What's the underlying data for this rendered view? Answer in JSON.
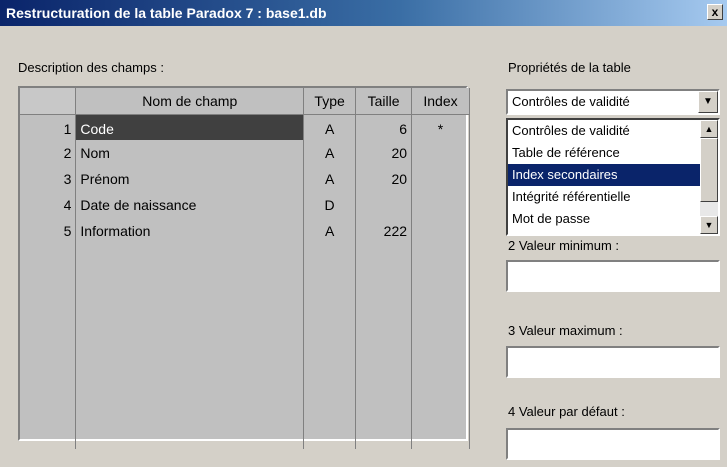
{
  "window": {
    "title": "Restructuration de la table Paradox 7 : base1.db",
    "close_label": "x"
  },
  "fields_section": {
    "label": "Description des champs :",
    "columns": [
      "",
      "Nom de champ",
      "Type",
      "Taille",
      "Index"
    ],
    "rows": [
      {
        "num": "1",
        "name": "Code",
        "type": "A",
        "size": "6",
        "index": "*"
      },
      {
        "num": "2",
        "name": "Nom",
        "type": "A",
        "size": "20",
        "index": ""
      },
      {
        "num": "3",
        "name": "Prénom",
        "type": "A",
        "size": "20",
        "index": ""
      },
      {
        "num": "4",
        "name": "Date de naissance",
        "type": "D",
        "size": "",
        "index": ""
      },
      {
        "num": "5",
        "name": "Information",
        "type": "A",
        "size": "222",
        "index": ""
      }
    ],
    "selected_row": 0
  },
  "table_properties": {
    "label": "Propriétés de la table",
    "selected": "Contrôles de validité",
    "dropdown_icon": "chevron-down-icon",
    "options": [
      "Contrôles de validité",
      "Table de référence",
      "Index secondaires",
      "Intégrité référentielle",
      "Mot de passe"
    ],
    "highlighted_option": 2
  },
  "validity": {
    "min_label": "2  Valeur minimum :",
    "min_value": "",
    "max_label": "3  Valeur maximum :",
    "max_value": "",
    "default_label": "4  Valeur par défaut :",
    "default_value": ""
  },
  "colors": {
    "title_start": "#0a246a",
    "title_end": "#a6caf0",
    "selection": "#404040",
    "list_highlight": "#0a246a",
    "dialog_bg": "#d4d0c8"
  }
}
